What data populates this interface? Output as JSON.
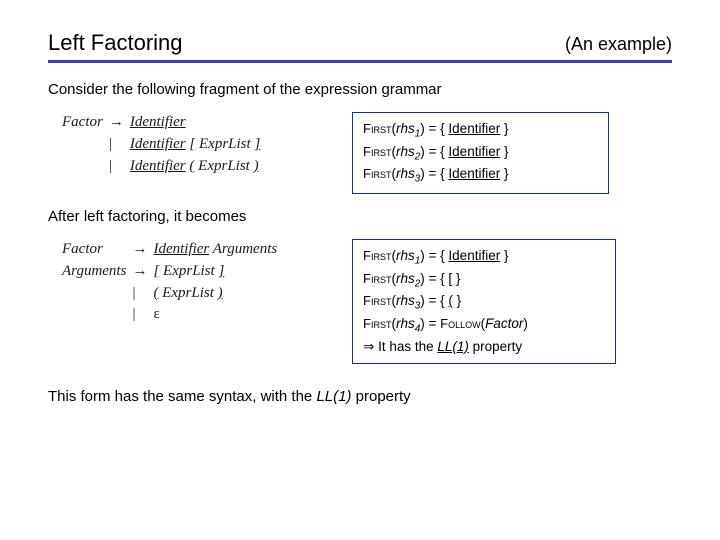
{
  "title": "Left Factoring",
  "subtitle": "(An  example)",
  "intro": "Consider the following fragment of the expression grammar",
  "grammar_before": {
    "lhs": "Factor",
    "arrow": "→",
    "bar": "|",
    "r1_a": "Identifier",
    "r2_a": "Identifier",
    "r2_b": "[",
    "r2_c": "ExprList",
    "r2_d": "]",
    "r3_a": "Identifier",
    "r3_b": "(",
    "r3_c": "ExprList",
    "r3_d": ")"
  },
  "firstbox_before": {
    "sc": "First",
    "l1_pre": "(",
    "l1_rhs": "rhs",
    "l1_sub": "1",
    "l1_mid": ") = { ",
    "l1_tok": "Identifier",
    "l1_post": " }",
    "l2_sub": "2",
    "l3_sub": "3"
  },
  "after_label": "After left factoring, it becomes",
  "grammar_after": {
    "lhs1": "Factor",
    "lhs2": "Arguments",
    "arrow": "→",
    "bar": "|",
    "r1_a": "Identifier",
    "r1_b": "Arguments",
    "r2_a": "[",
    "r2_b": "ExprList",
    "r2_c": "]",
    "r3_a": "(",
    "r3_b": "ExprList",
    "r3_c": ")",
    "r4_a": "ε"
  },
  "firstbox_after": {
    "sc": "First",
    "l1_sub": "1",
    "l1_tok": "Identifier",
    "l2_sub": "2",
    "l2_tok": "[",
    "l3_sub": "3",
    "l3_tok": "(",
    "l4_sub": "4",
    "l4_follow_sc": "Follow",
    "l4_follow_arg": "Factor",
    "impl": "⇒",
    "concl_a": " It has the ",
    "concl_b": "LL(1)",
    "concl_c": " property",
    "pre": "(",
    "rhs": "rhs",
    "mid_set": ") = { ",
    "post": " }",
    "mid_eq": ") = "
  },
  "footer_a": "This form has the same syntax, with the ",
  "footer_b": "LL(1)",
  "footer_c": " property"
}
